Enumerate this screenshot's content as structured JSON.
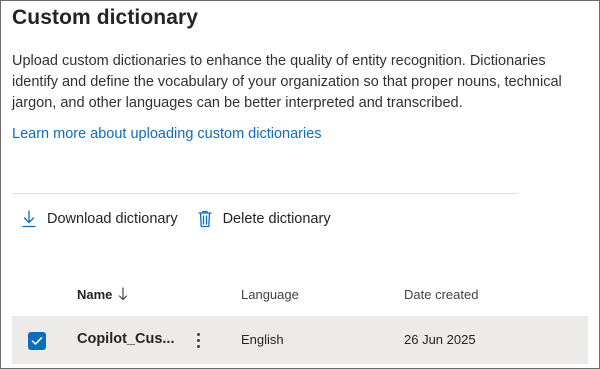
{
  "page": {
    "title": "Custom dictionary",
    "description": "Upload custom dictionaries to enhance the quality of entity recognition. Dictionaries identify and define the vocabulary of your organization so that proper nouns, technical jargon, and other languages can be better interpreted and transcribed.",
    "learn_more_link": "Learn more about uploading custom dictionaries"
  },
  "toolbar": {
    "download_label": "Download dictionary",
    "download_icon": "download-icon",
    "delete_label": "Delete dictionary",
    "delete_icon": "trash-icon"
  },
  "table": {
    "columns": {
      "name": "Name",
      "language": "Language",
      "date_created": "Date created"
    },
    "sort_icon": "arrow-down-icon",
    "rows": [
      {
        "selected": true,
        "name": "Copilot_Cus...",
        "language": "English",
        "date_created": "26 Jun 2025"
      }
    ]
  },
  "colors": {
    "accent": "#0f6cbd",
    "link": "#0f6cbd",
    "row_selected_bg": "#edebe9",
    "text": "#242424"
  }
}
